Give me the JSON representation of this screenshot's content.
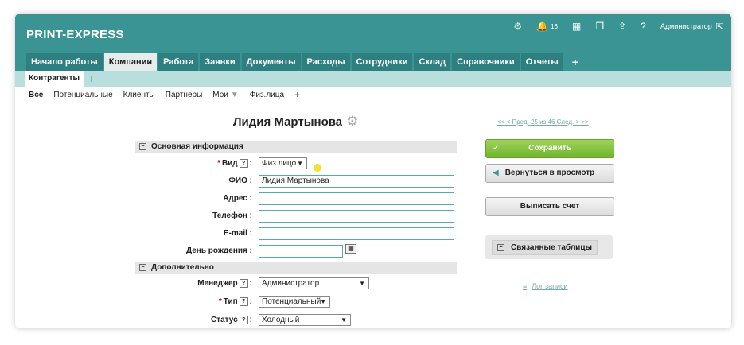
{
  "app": {
    "title": "PRINT-EXPRESS"
  },
  "topbar": {
    "notifications_count": "16",
    "user": "Администратор"
  },
  "tabs": [
    "Начало работы",
    "Компании",
    "Работа",
    "Заявки",
    "Документы",
    "Расходы",
    "Сотрудники",
    "Склад",
    "Справочники",
    "Отчеты",
    "+"
  ],
  "subtabs": {
    "active": "Контрагенты",
    "add": "+"
  },
  "filters": [
    "Все",
    "Потенциальные",
    "Клиенты",
    "Партнеры",
    "Мои",
    "Физ.лица",
    "+"
  ],
  "record": {
    "title": "Лидия Мартынова"
  },
  "pager": {
    "text": "<< < Пред. 25 из 46 След. > >>"
  },
  "sections": {
    "main": "Основная информация",
    "extra": "Дополнительно"
  },
  "form": {
    "type_label": "Вид",
    "type_value": "Физ.лицо",
    "name_label": "ФИО",
    "name_value": "Лидия Мартынова",
    "address_label": "Адрес",
    "phone_label": "Телефон",
    "email_label": "E-mail",
    "birthday_label": "День рождения",
    "manager_label": "Менеджер",
    "manager_value": "Администратор",
    "ctype_label": "Тип",
    "ctype_value": "Потенциальный",
    "status_label": "Статус",
    "status_value": "Холодный",
    "colon": ":"
  },
  "actions": {
    "save": "Сохранить",
    "back": "Вернуться в просмотр",
    "invoice": "Выписать счет",
    "related": "Связанные таблицы",
    "log": "Лог записи"
  },
  "icons": [
    "gear-icon",
    "bell-icon",
    "calendar-icon",
    "chat-icon",
    "export-icon",
    "help-icon",
    "logout-icon"
  ]
}
